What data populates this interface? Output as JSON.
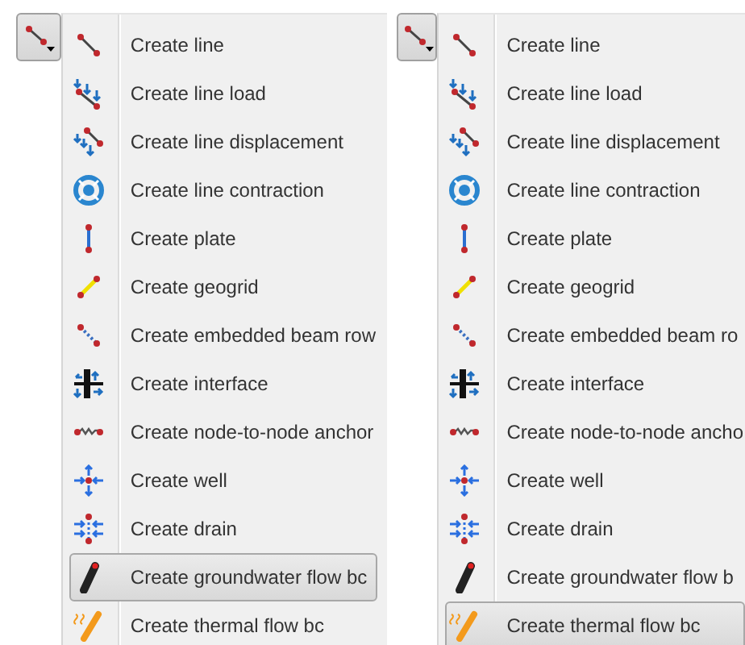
{
  "panels": [
    {
      "button": {
        "pressed": true
      },
      "items": [
        {
          "label": "Create line",
          "selected": false
        },
        {
          "label": "Create line load",
          "selected": false
        },
        {
          "label": "Create line displacement",
          "selected": false
        },
        {
          "label": "Create line contraction",
          "selected": false
        },
        {
          "label": "Create plate",
          "selected": false
        },
        {
          "label": "Create geogrid",
          "selected": false
        },
        {
          "label": "Create embedded beam row",
          "selected": false
        },
        {
          "label": "Create interface",
          "selected": false
        },
        {
          "label": "Create node-to-node anchor",
          "selected": false
        },
        {
          "label": "Create well",
          "selected": false
        },
        {
          "label": "Create drain",
          "selected": false
        },
        {
          "label": "Create groundwater flow bc",
          "selected": true
        },
        {
          "label": "Create thermal flow bc",
          "selected": false
        }
      ]
    },
    {
      "button": {
        "pressed": true
      },
      "items": [
        {
          "label": "Create line",
          "selected": false
        },
        {
          "label": "Create line load",
          "selected": false
        },
        {
          "label": "Create line displacement",
          "selected": false
        },
        {
          "label": "Create line contraction",
          "selected": false
        },
        {
          "label": "Create plate",
          "selected": false
        },
        {
          "label": "Create geogrid",
          "selected": false
        },
        {
          "label": "Create embedded beam ro",
          "selected": false
        },
        {
          "label": "Create interface",
          "selected": false
        },
        {
          "label": "Create node-to-node ancho",
          "selected": false
        },
        {
          "label": "Create well",
          "selected": false
        },
        {
          "label": "Create drain",
          "selected": false
        },
        {
          "label": "Create groundwater flow b",
          "selected": false
        },
        {
          "label": "Create thermal flow bc",
          "selected": true
        }
      ]
    }
  ]
}
